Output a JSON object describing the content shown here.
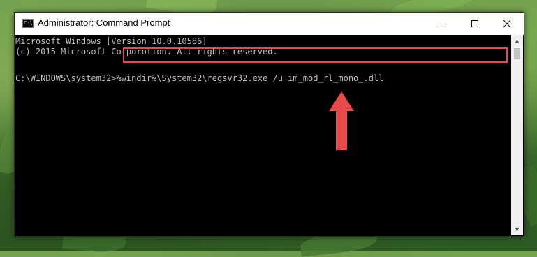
{
  "window": {
    "title": "Administrator: Command Prompt",
    "app_icon_text": "C:\\"
  },
  "console": {
    "lines": [
      "Microsoft Windows [Version 10.0.10586]",
      "(c) 2015 Microsoft Corporotion. All rights reserved.",
      ""
    ],
    "prompt": "C:\\WINDOWS\\system32>",
    "command": "%windir%\\System32\\regsvr32.exe /u im_mod_rl_mono_.dll"
  },
  "colors": {
    "highlight": "#e84a4a",
    "console_text": "#c0c0c0",
    "console_bg": "#000000"
  },
  "icons": {
    "minimize": "minimize-icon",
    "maximize": "maximize-icon",
    "close": "close-icon",
    "scroll_up": "scroll-up-arrow-icon",
    "scroll_down": "scroll-down-arrow-icon",
    "annotation": "red-up-arrow-icon"
  }
}
